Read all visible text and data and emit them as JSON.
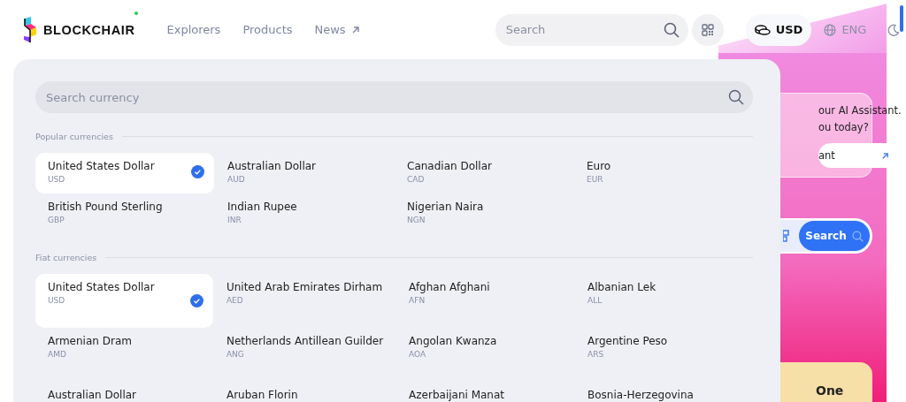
{
  "header": {
    "logo": "BLOCKCHAIR",
    "nav": [
      {
        "label": "Explorers",
        "external": false
      },
      {
        "label": "Products",
        "external": false
      },
      {
        "label": "News",
        "external": true
      }
    ],
    "search": {
      "placeholder": "Search"
    },
    "currency": "USD",
    "language": "ENG"
  },
  "background": {
    "assistant_lines": [
      "our AI Assistant.",
      "ou today?"
    ],
    "assistant_button": "ant",
    "search_button": "Search",
    "card_title": "One"
  },
  "dropdown": {
    "search": {
      "placeholder": "Search currency"
    },
    "sections": [
      {
        "title": "Popular currencies",
        "items": [
          {
            "name": "United States Dollar",
            "code": "USD",
            "selected": true
          },
          {
            "name": "Australian Dollar",
            "code": "AUD",
            "selected": false
          },
          {
            "name": "Canadian Dollar",
            "code": "CAD",
            "selected": false
          },
          {
            "name": "Euro",
            "code": "EUR",
            "selected": false
          },
          {
            "name": "British Pound Sterling",
            "code": "GBP",
            "selected": false
          },
          {
            "name": "Indian Rupee",
            "code": "INR",
            "selected": false
          },
          {
            "name": "Nigerian Naira",
            "code": "NGN",
            "selected": false
          }
        ]
      },
      {
        "title": "Fiat currencies",
        "items": [
          {
            "name": "United States Dollar",
            "code": "USD",
            "selected": true
          },
          {
            "name": "United Arab Emirates Dirham",
            "code": "AED",
            "selected": false
          },
          {
            "name": "Afghan Afghani",
            "code": "AFN",
            "selected": false
          },
          {
            "name": "Albanian Lek",
            "code": "ALL",
            "selected": false
          },
          {
            "name": "Armenian Dram",
            "code": "AMD",
            "selected": false
          },
          {
            "name": "Netherlands Antillean Guilder",
            "code": "ANG",
            "selected": false
          },
          {
            "name": "Angolan Kwanza",
            "code": "AOA",
            "selected": false
          },
          {
            "name": "Argentine Peso",
            "code": "ARS",
            "selected": false
          },
          {
            "name": "Australian Dollar",
            "selected": false
          },
          {
            "name": "Aruban Florin",
            "selected": false
          },
          {
            "name": "Azerbaijani Manat",
            "selected": false
          },
          {
            "name": "Bosnia-Herzegovina",
            "selected": false
          }
        ]
      }
    ]
  }
}
